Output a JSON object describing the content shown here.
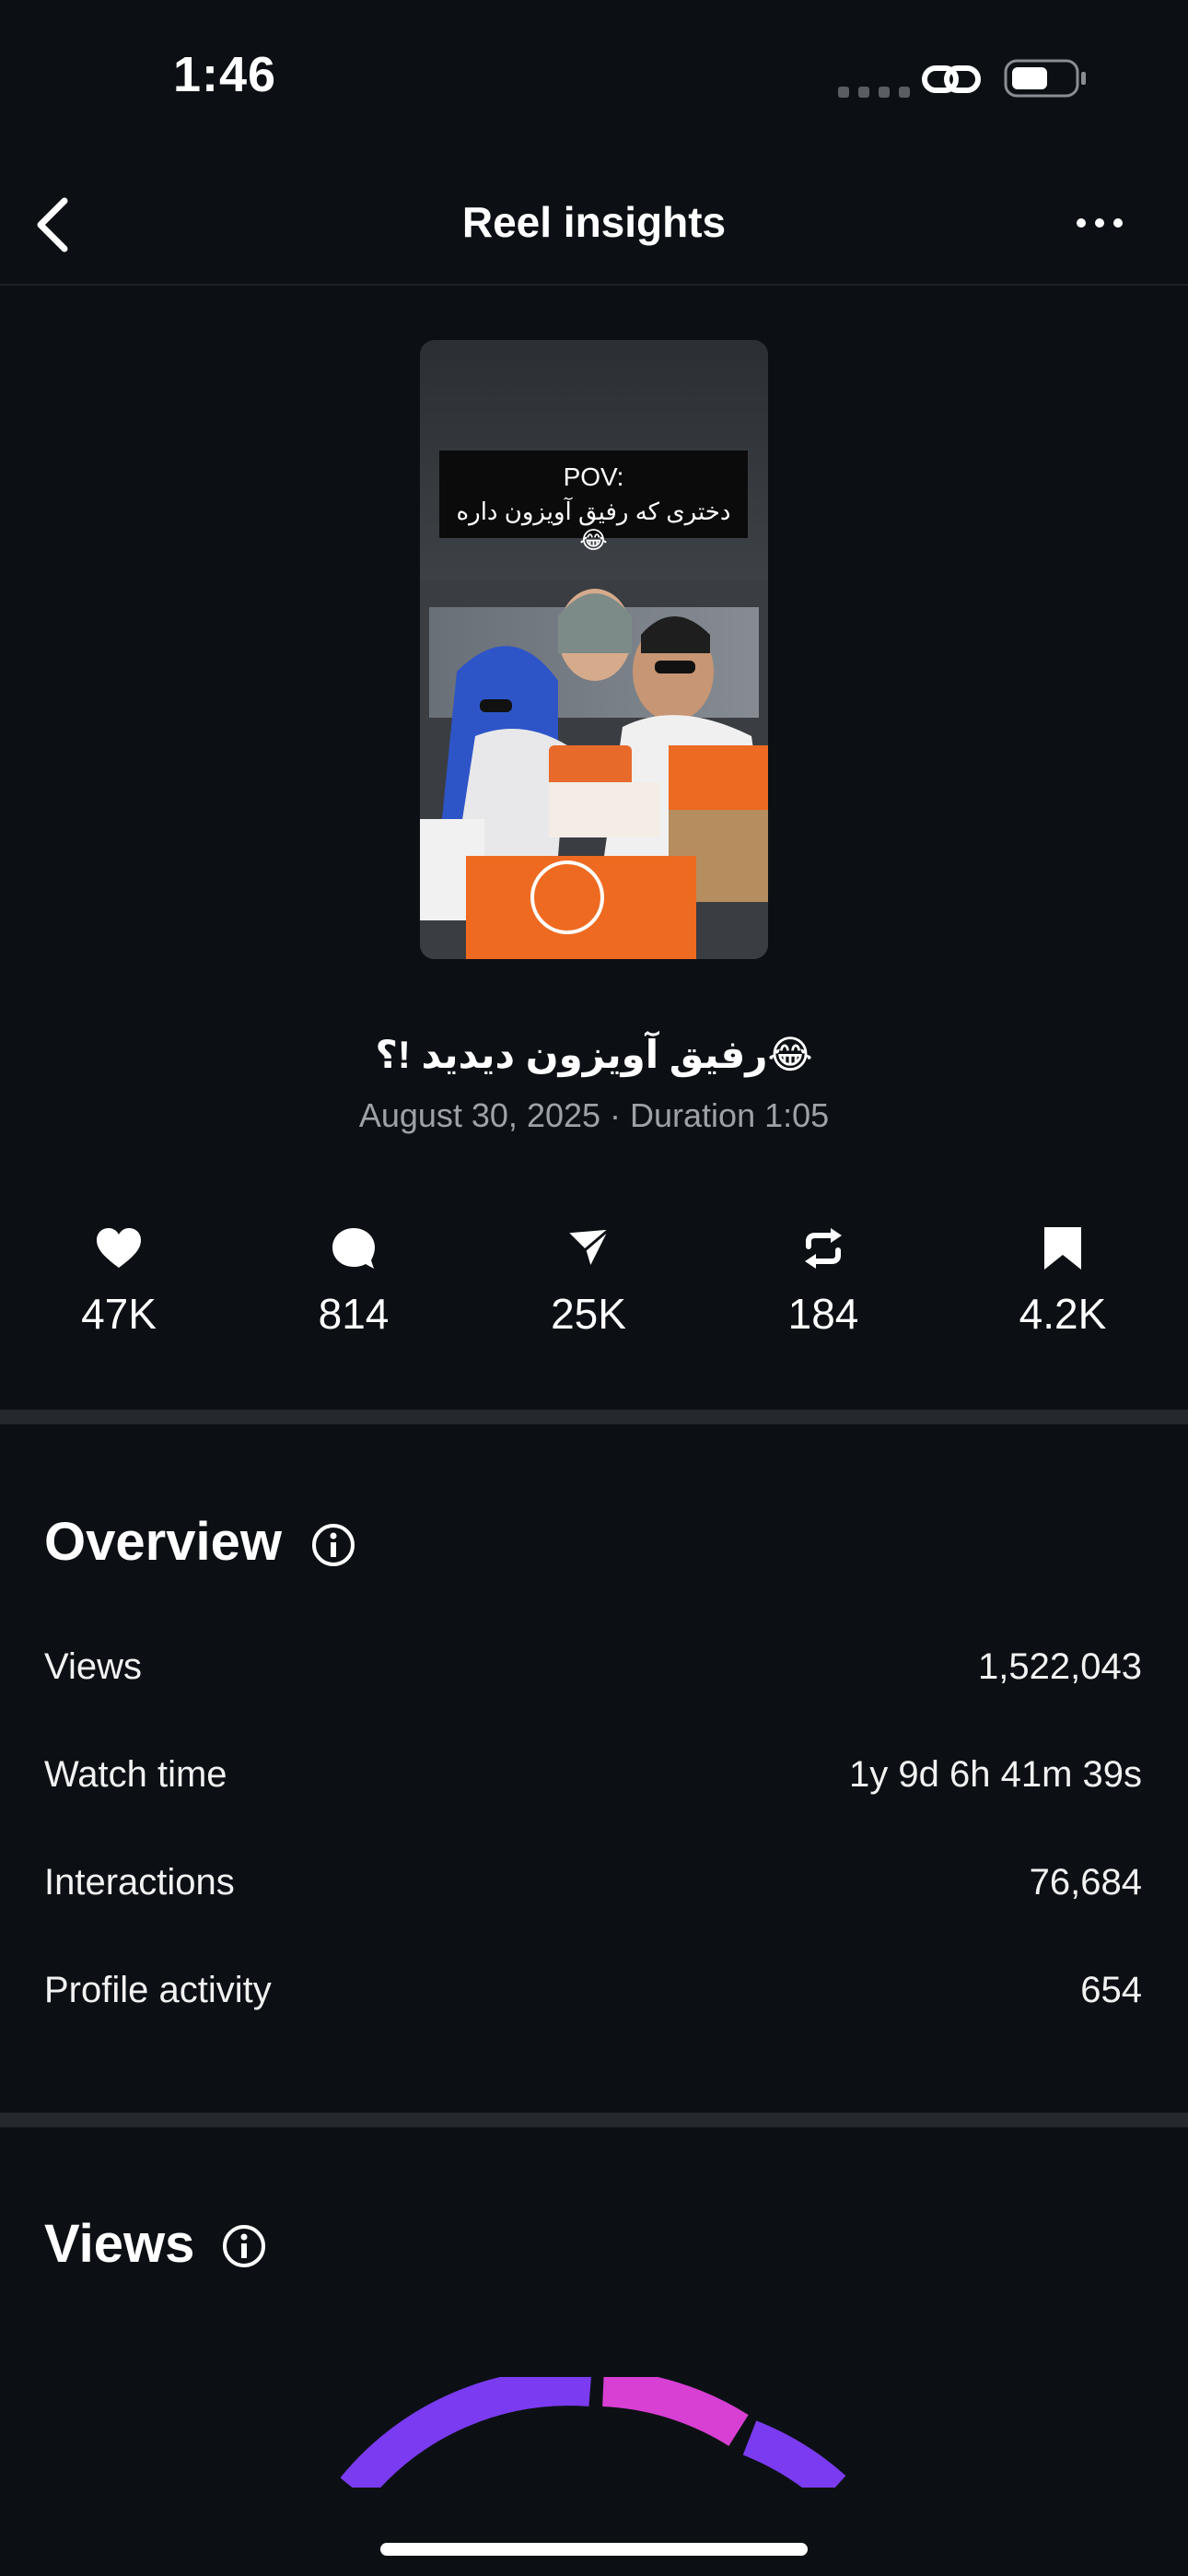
{
  "status_bar": {
    "time": "1:46"
  },
  "header": {
    "title": "Reel insights"
  },
  "reel": {
    "thumbnail_overlay_line1": "POV:",
    "thumbnail_overlay_line2": "دختری که رفیق آویزون داره 😂",
    "caption": "رفیق آویزون دیدید !؟😂",
    "meta": "August 30, 2025 · Duration 1:05"
  },
  "stats": {
    "likes": "47K",
    "comments": "814",
    "shares": "25K",
    "reposts": "184",
    "saves": "4.2K"
  },
  "overview": {
    "title": "Overview",
    "rows": [
      {
        "label": "Views",
        "value": "1,522,043"
      },
      {
        "label": "Watch time",
        "value": "1y 9d 6h 41m 39s"
      },
      {
        "label": "Interactions",
        "value": "76,684"
      },
      {
        "label": "Profile activity",
        "value": "654"
      }
    ]
  },
  "views_section": {
    "title": "Views"
  },
  "colors": {
    "background": "#0c1014",
    "divider": "#25292e",
    "text_primary": "#ffffff",
    "text_secondary": "#9ea2a8",
    "arc_purple": "#7b3bf0",
    "arc_magenta": "#d83fd3"
  },
  "icons": {
    "back": "chevron-left-icon",
    "more": "more-horizontal-icon",
    "likes": "heart-icon",
    "comments": "comment-icon",
    "shares": "send-icon",
    "reposts": "repost-icon",
    "saves": "bookmark-icon",
    "info": "info-icon"
  }
}
